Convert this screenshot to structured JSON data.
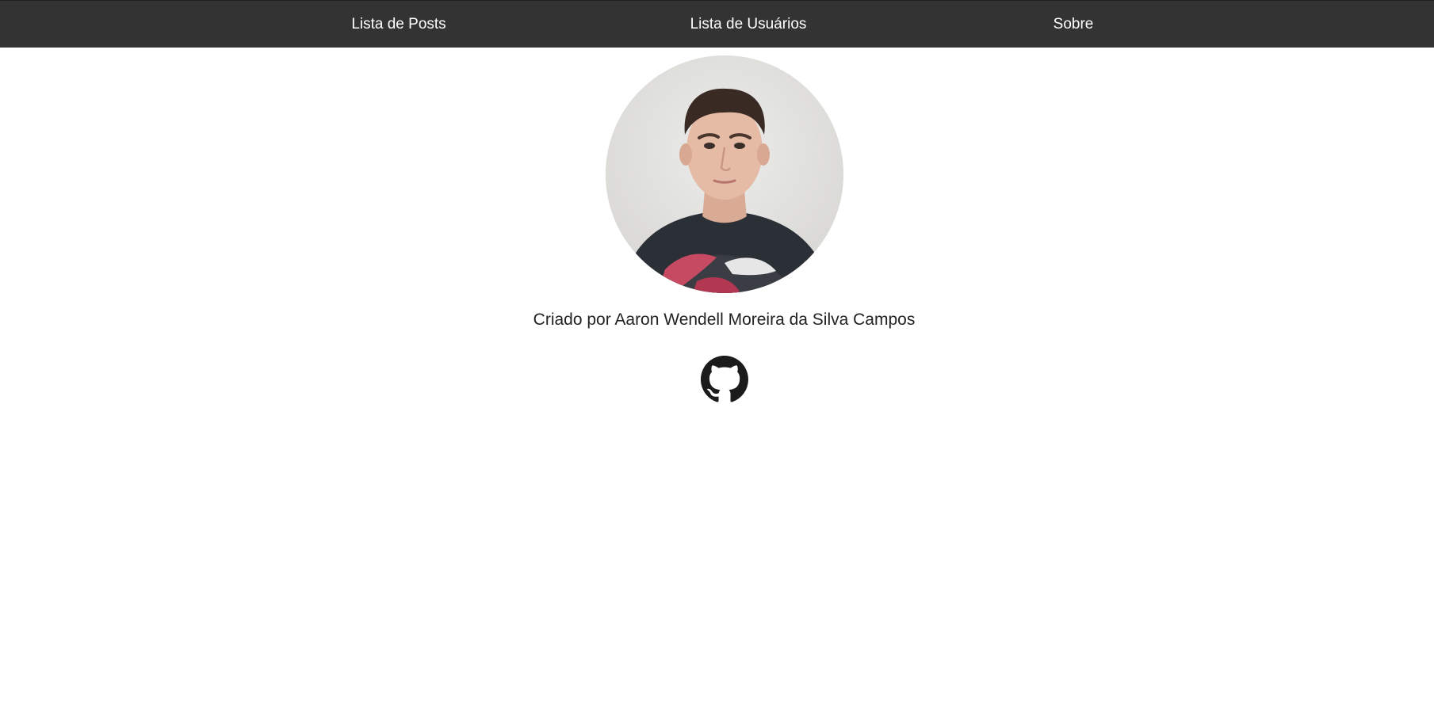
{
  "nav": {
    "items": [
      {
        "label": "Lista de Posts"
      },
      {
        "label": "Lista de Usuários"
      },
      {
        "label": "Sobre"
      }
    ]
  },
  "about": {
    "credit": "Criado por Aaron Wendell Moreira da Silva Campos",
    "avatar_icon": "profile-photo",
    "github_icon": "github-icon"
  },
  "colors": {
    "navbar_bg": "#333333",
    "nav_text": "#ffffff",
    "page_bg": "#ffffff",
    "text": "#222222"
  }
}
